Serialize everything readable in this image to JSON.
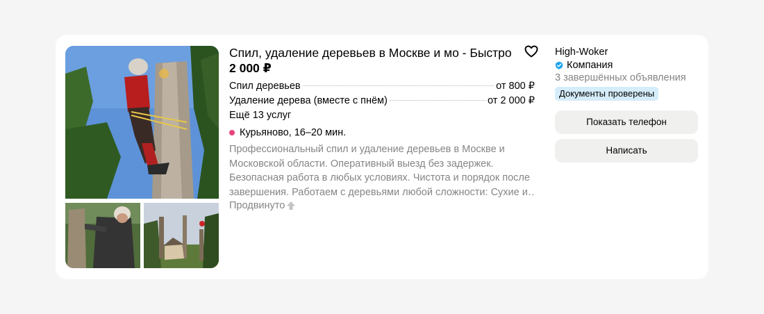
{
  "listing": {
    "title": "Спил, удаление деревьев в Москве и мо - Быстро",
    "price": "2 000 ₽",
    "services": [
      {
        "name": "Спил деревьев",
        "price": "от 800 ₽"
      },
      {
        "name": "Удаление дерева (вместе с пнём)",
        "price": "от 2 000 ₽"
      }
    ],
    "more_services": "Ещё 13 услуг",
    "location": "Курьяново, 16–20 мин.",
    "description_lines": [
      "Профессиональный спил и удаление деревьев в Москве и",
      "Московской области. Оперативный выезд без задержек.",
      "Безопасная работа в любых условиях. Чистота и порядок после",
      "завершения. Работаем с деревьями любой сложности: Сухие и…"
    ],
    "promoted": "Продвинуто",
    "favorite_icon": "heart-outline-icon",
    "metro_color": "#e8457c"
  },
  "seller": {
    "name": "High-Woker",
    "type": "Компания",
    "type_icon": "verified-check-icon",
    "ads": "3 завершённых объявления",
    "badge": "Документы проверены",
    "badge_color": "#d5ecfa"
  },
  "buttons": {
    "phone": "Показать телефон",
    "write": "Написать"
  }
}
